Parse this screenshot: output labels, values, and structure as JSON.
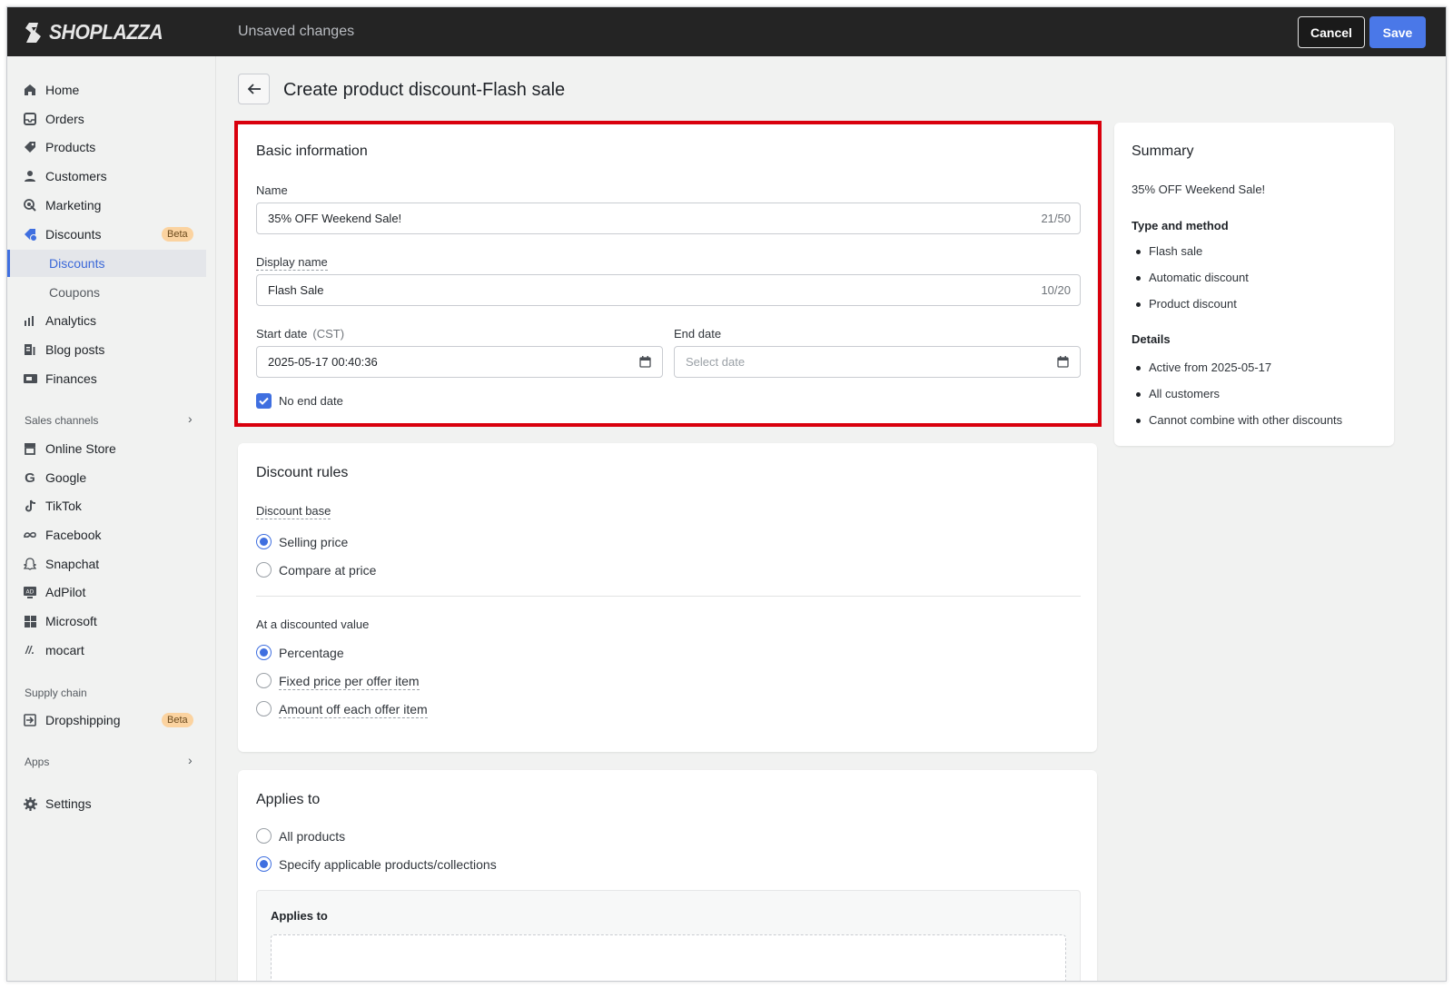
{
  "topbar": {
    "brand": "SHOPLAZZA",
    "status": "Unsaved changes",
    "cancel_label": "Cancel",
    "save_label": "Save"
  },
  "sidebar": {
    "items": [
      {
        "label": "Home",
        "icon": "home-icon"
      },
      {
        "label": "Orders",
        "icon": "inbox-icon"
      },
      {
        "label": "Products",
        "icon": "tag-icon"
      },
      {
        "label": "Customers",
        "icon": "person-icon"
      },
      {
        "label": "Marketing",
        "icon": "target-icon"
      },
      {
        "label": "Discounts",
        "icon": "discount-icon",
        "badge": "Beta"
      },
      {
        "label": "Discounts"
      },
      {
        "label": "Coupons"
      },
      {
        "label": "Analytics",
        "icon": "bar-chart-icon"
      },
      {
        "label": "Blog posts",
        "icon": "blog-icon"
      },
      {
        "label": "Finances",
        "icon": "finance-icon"
      }
    ],
    "sales_channels_label": "Sales channels",
    "channels": [
      {
        "label": "Online Store",
        "icon": "store-icon"
      },
      {
        "label": "Google",
        "icon": "google-icon"
      },
      {
        "label": "TikTok",
        "icon": "tiktok-icon"
      },
      {
        "label": "Facebook",
        "icon": "meta-icon"
      },
      {
        "label": "Snapchat",
        "icon": "snapchat-icon"
      },
      {
        "label": "AdPilot",
        "icon": "adpilot-icon"
      },
      {
        "label": "Microsoft",
        "icon": "microsoft-icon"
      },
      {
        "label": "mocart",
        "icon": "mocart-icon"
      }
    ],
    "supply_chain_label": "Supply chain",
    "dropshipping": {
      "label": "Dropshipping",
      "badge": "Beta",
      "icon": "dropshipping-icon"
    },
    "apps_label": "Apps",
    "settings_label": "Settings"
  },
  "page": {
    "title": "Create product discount-Flash sale"
  },
  "basic_info": {
    "title": "Basic information",
    "name_label": "Name",
    "name_value": "35% OFF Weekend Sale!",
    "name_count": "21/50",
    "display_name_label": "Display name",
    "display_name_value": "Flash Sale",
    "display_name_count": "10/20",
    "start_date_label": "Start date",
    "start_date_tz": "(CST)",
    "start_date_value": "2025-05-17 00:40:36",
    "end_date_label": "End date",
    "end_date_placeholder": "Select date",
    "no_end_date_label": "No end date",
    "no_end_date_checked": true
  },
  "discount_rules": {
    "title": "Discount rules",
    "base_label": "Discount base",
    "base_options": [
      "Selling price",
      "Compare at price"
    ],
    "base_selected": "Selling price",
    "value_label": "At a discounted value",
    "value_options": [
      "Percentage",
      "Fixed price per offer item",
      "Amount off each offer item"
    ],
    "value_selected": "Percentage"
  },
  "applies_to": {
    "title": "Applies to",
    "options": [
      "All products",
      "Specify applicable products/collections"
    ],
    "selected": "Specify applicable products/collections",
    "inner_title": "Applies to"
  },
  "summary": {
    "title": "Summary",
    "name": "35% OFF Weekend Sale!",
    "type_heading": "Type and method",
    "type_items": [
      "Flash sale",
      "Automatic discount",
      "Product discount"
    ],
    "details_heading": "Details",
    "details_items": [
      "Active from 2025-05-17",
      "All customers",
      "Cannot combine with other discounts"
    ]
  },
  "colors": {
    "accent": "#3f6fe0",
    "highlight": "#d9000d",
    "topbar": "#242424"
  }
}
